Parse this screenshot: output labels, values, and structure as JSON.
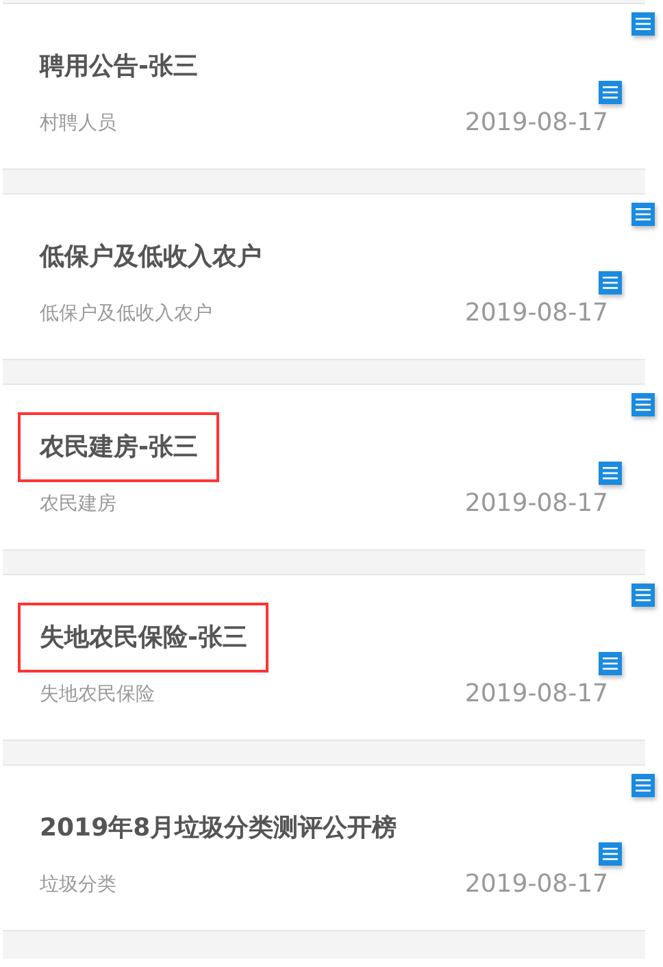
{
  "items": [
    {
      "title": "聘用公告-张三",
      "highlighted": false,
      "category": "村聘人员",
      "date": "2019-08-17"
    },
    {
      "title": "低保户及低收入农户",
      "highlighted": false,
      "category": "低保户及低收入农户",
      "date": "2019-08-17"
    },
    {
      "title": "农民建房-张三",
      "highlighted": true,
      "category": "农民建房",
      "date": "2019-08-17"
    },
    {
      "title": "失地农民保险-张三",
      "highlighted": true,
      "category": "失地农民保险",
      "date": "2019-08-17"
    },
    {
      "title": "2019年8月垃圾分类测评公开榜",
      "highlighted": false,
      "category": "垃圾分类",
      "date": "2019-08-17"
    }
  ]
}
